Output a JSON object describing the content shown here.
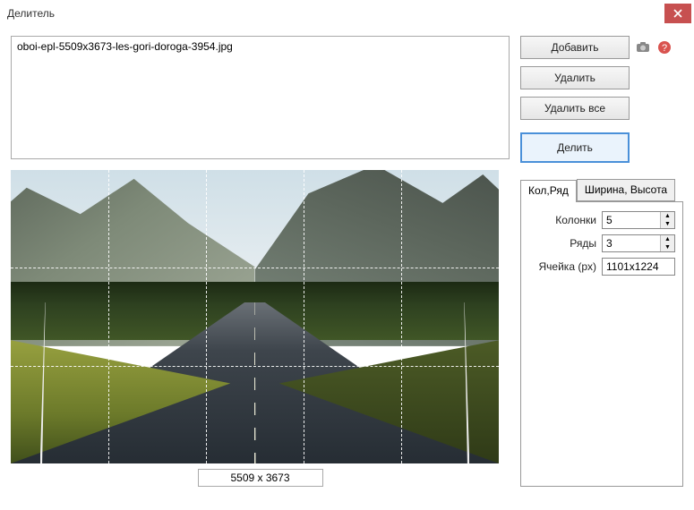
{
  "window": {
    "title": "Делитель"
  },
  "filelist": {
    "items": [
      "oboi-epl-5509x3673-les-gori-doroga-3954.jpg"
    ]
  },
  "buttons": {
    "add": "Добавить",
    "remove": "Удалить",
    "remove_all": "Удалить все",
    "split": "Делить"
  },
  "tabs": {
    "colrow": "Кол,Ряд",
    "wh": "Ширина, Высота"
  },
  "form": {
    "columns_label": "Колонки",
    "columns_value": "5",
    "rows_label": "Ряды",
    "rows_value": "3",
    "cell_label": "Ячейка (px)",
    "cell_value": "1101x1224"
  },
  "preview": {
    "dimensions": "5509 x 3673"
  },
  "grid": {
    "cols": 5,
    "rows": 3
  }
}
